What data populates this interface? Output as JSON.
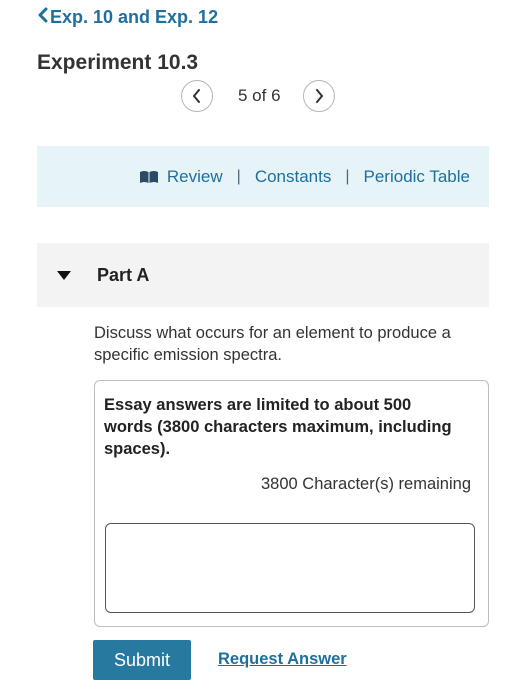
{
  "nav": {
    "back_label": "Exp. 10 and Exp. 12",
    "title": "Experiment 10.3",
    "pager": "5 of 6"
  },
  "resources": {
    "review": "Review",
    "separator": "|",
    "constants": "Constants",
    "periodic_table": "Periodic Table"
  },
  "part": {
    "label": "Part A",
    "question": "Discuss what occurs for an element to produce a specific emission spectra."
  },
  "essay": {
    "limit_text": "Essay answers are limited to about 500 words (3800 characters maximum, including spaces).",
    "remaining": "3800 Character(s) remaining",
    "value": ""
  },
  "actions": {
    "submit": "Submit",
    "request_answer": "Request Answer"
  },
  "colors": {
    "accent": "#1f6f9e",
    "button": "#2779a0",
    "resource_bar_bg": "#e6f4f7",
    "part_header_bg": "#f3f3f3"
  },
  "icons": {
    "back": "chevron-left-icon",
    "prev": "chevron-left-icon",
    "next": "chevron-right-icon",
    "review": "book-icon",
    "part_toggle": "caret-down-icon"
  }
}
